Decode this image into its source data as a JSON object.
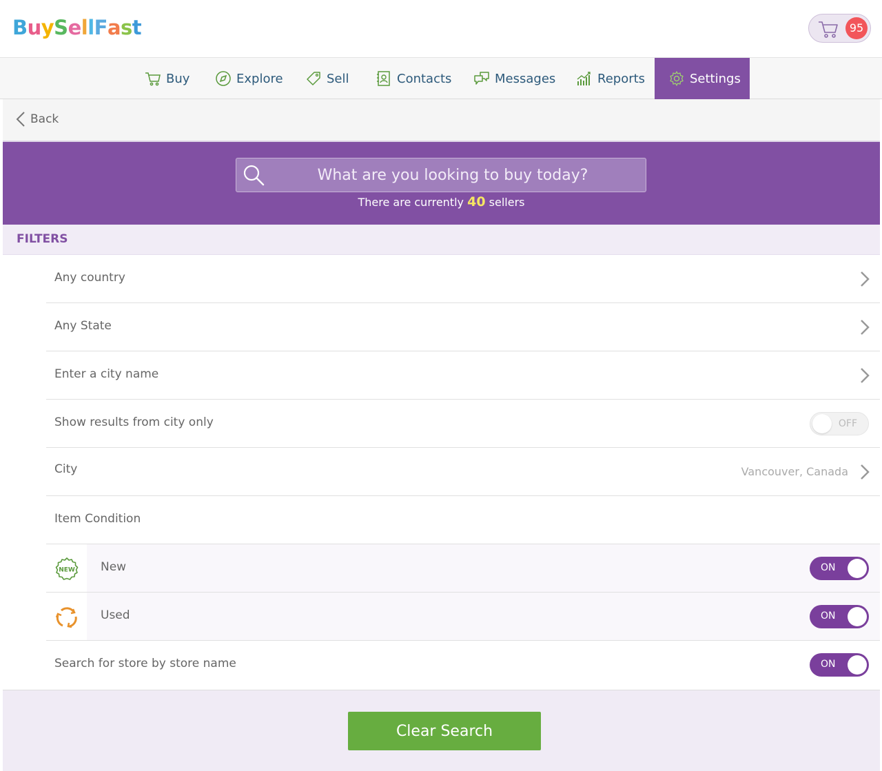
{
  "app": {
    "logo_letters": [
      "B",
      "u",
      "y",
      "S",
      "e",
      "l",
      "l",
      "F",
      "a",
      "s",
      "t"
    ],
    "logo_colors": [
      "#3fa6d9",
      "#e85d8a",
      "#f4b400",
      "#58b85f",
      "#e56aa0",
      "#f0a73a",
      "#4fb7e5",
      "#5aa9df",
      "#f27c4b",
      "#8bc34a",
      "#3d9ad9"
    ],
    "cart_count": "95"
  },
  "nav": {
    "items": [
      {
        "label": "Buy",
        "icon": "cart-icon"
      },
      {
        "label": "Explore",
        "icon": "compass-icon"
      },
      {
        "label": "Sell",
        "icon": "tag-icon"
      },
      {
        "label": "Contacts",
        "icon": "contacts-icon"
      },
      {
        "label": "Messages",
        "icon": "messages-icon"
      },
      {
        "label": "Reports",
        "icon": "reports-icon"
      },
      {
        "label": "Settings",
        "icon": "gear-icon",
        "active": true
      }
    ]
  },
  "back": {
    "label": "Back"
  },
  "search": {
    "placeholder": "What are you looking to buy today?",
    "sellers_prefix": "There are currently",
    "sellers_count": "40",
    "sellers_suffix": "sellers"
  },
  "filters": {
    "title": "FILTERS",
    "country": "Any country",
    "state": "Any State",
    "city_input": "Enter a city name",
    "city_only": {
      "label": "Show results from city only",
      "state": "OFF"
    },
    "city": {
      "label": "City",
      "value": "Vancouver, Canada"
    },
    "item_condition": "Item Condition",
    "new": {
      "label": "New",
      "state": "ON",
      "icon_text": "NEW"
    },
    "used": {
      "label": "Used",
      "state": "ON"
    },
    "store": {
      "label": "Search for store by store name",
      "state": "ON"
    }
  },
  "actions": {
    "clear": "Clear Search"
  },
  "colors": {
    "brand_purple": "#8150a3",
    "accent_green": "#67ad40",
    "badge_red": "#f2555a",
    "highlight_yellow": "#f5e663"
  }
}
